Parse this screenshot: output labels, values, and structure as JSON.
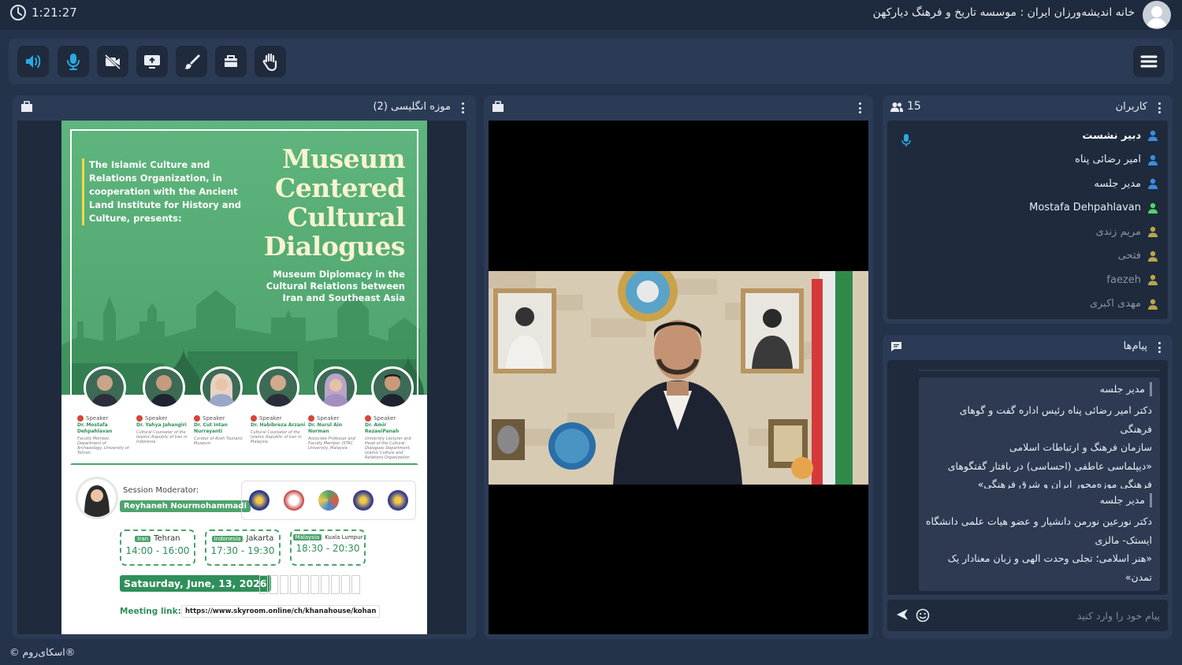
{
  "topbar": {
    "timer": "1:21:27",
    "room_title": "خانه اندیشه‌ورزان ایران : موسسه تاریخ و فرهنگ دیارکهن"
  },
  "toolbar": {
    "buttons": [
      "speaker-icon",
      "microphone-icon",
      "camera-off-icon",
      "screen-share-icon",
      "brush-icon",
      "folder-icon",
      "raise-hand-icon"
    ],
    "active_accent": "#2aa9e0"
  },
  "document_panel": {
    "title": "موزه انگلیسی (2)",
    "poster": {
      "intro": "The Islamic Culture and Relations Organization, in cooperation with the Ancient Land Institute for History and Culture, presents:",
      "title_lines": [
        "Museum",
        "Centered",
        "Cultural",
        "Dialogues"
      ],
      "subtitle": "Museum Diplomacy in the Cultural Relations between Iran and Southeast Asia",
      "speakers": [
        {
          "role": "Speaker",
          "name": "Dr. Mostafa Dehpahlavan",
          "desc": "Faculty Member, Department of Archaeology, University of Tehran"
        },
        {
          "role": "Speaker",
          "name": "Dr. Yahya Jahangiri",
          "desc": "Cultural Counselor of the Islamic Republic of Iran in Indonesia"
        },
        {
          "role": "Speaker",
          "name": "Dr. Cut Intan Nurrayanti",
          "desc": "Curator of Aceh Tsunami Museum"
        },
        {
          "role": "Speaker",
          "name": "Dr. Habibreza Arzani",
          "desc": "Cultural Counselor of the Islamic Republic of Iran in Malaysia"
        },
        {
          "role": "Speaker",
          "name": "Dr. Nurul Ain Norman",
          "desc": "Associate Professor and Faculty Member, ISTAC University, Malaysia"
        },
        {
          "role": "Speaker",
          "name": "Dr. Amir RezaeiPanah",
          "desc": "University Lecturer and Head of the Cultural Dialogues Department, Islamic Culture and Relations Organization"
        }
      ],
      "moderator_label": "Session Moderator:",
      "moderator_name": "Reyhaneh Nourmohammadi",
      "times": [
        {
          "country": "Iran",
          "city": "Tehran",
          "hours": "14:00 - 16:00"
        },
        {
          "country": "Indonesia",
          "city": "Jakarta",
          "hours": "17:30 - 19:30"
        },
        {
          "country": "Malaysia",
          "city": "Kuala Lumpur",
          "hours": "18:30 - 20:30"
        }
      ],
      "date": "Sataurday, June, 13, 2026",
      "link_label": "Meeting link:",
      "link": "https://www.skyroom.online/ch/khanahouse/kohan",
      "colors": {
        "green": "#4ea36c",
        "dark_green": "#2f8f5a",
        "cream": "#f8f4d0",
        "accent_yellow": "#f5d94a"
      }
    }
  },
  "video_panel": {},
  "users_panel": {
    "title": "کاربران",
    "count": "15",
    "users": [
      {
        "name": "دبیر نشست",
        "style": "bold",
        "icon_color": "#3b8de0"
      },
      {
        "name": "امیر رضائی پناه",
        "style": "white",
        "icon_color": "#3b8de0"
      },
      {
        "name": "مدیر جلسه",
        "style": "white",
        "icon_color": "#3b8de0"
      },
      {
        "name": "Mostafa Dehpahlavan",
        "style": "white",
        "icon_color": "#4cd964"
      },
      {
        "name": "مریم زندی",
        "style": "grey",
        "icon_color": "#b8a64a"
      },
      {
        "name": "فتحی",
        "style": "grey",
        "icon_color": "#b8a64a"
      },
      {
        "name": "faezeh",
        "style": "grey",
        "icon_color": "#b8a64a"
      },
      {
        "name": "مهدی اکبری",
        "style": "grey",
        "icon_color": "#b8a64a"
      }
    ]
  },
  "chat_panel": {
    "title": "پیام‌ها",
    "messages": [
      {
        "sender": "مدیر جلسه",
        "lines": [
          "دکتر امیر رضائی پناه رئیس اداره گفت و گوهای فرهنگی",
          "سازمان فرهنگ و ارتباطات اسلامی",
          "«دیپلماسی عاطفی (احساسی) در بافتار گفتگوهای",
          "فرهنگی موزه‌محور ایران و شرق فرهنگی»"
        ]
      },
      {
        "sender": "مدیر جلسه",
        "lines": [
          "دکتر نورعین نورمن دانشیار و عضو هیات علمی دانشگاه",
          "ایستک- مالزی",
          "«هنر اسلامی؛ تجلی وحدت الهی و زبان معنادار یک",
          "تمدن»"
        ]
      }
    ],
    "input_placeholder": "پیام خود را وارد کنید"
  },
  "footer": {
    "brand": "®اسکای‌روم ©"
  }
}
